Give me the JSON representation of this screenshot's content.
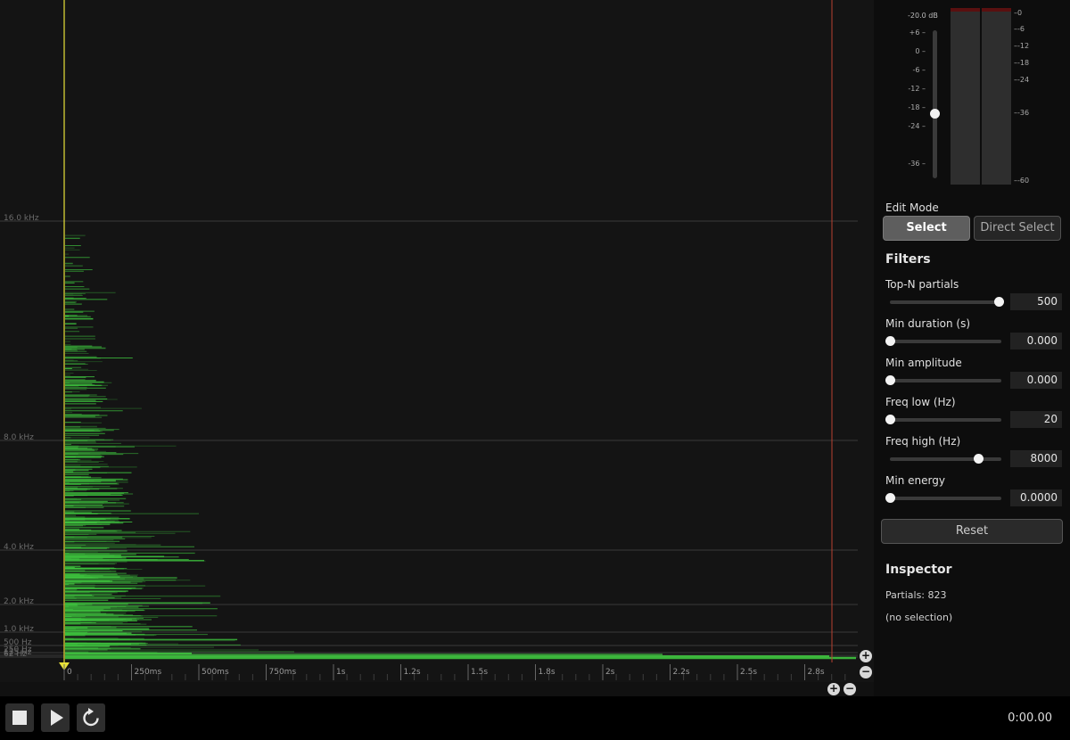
{
  "spectrogram": {
    "freq_labels": [
      "16.0 kHz",
      "8.0 kHz",
      "4.0 kHz",
      "2.0 kHz",
      "1.0 kHz",
      "500 Hz",
      "250 Hz",
      "125 Hz",
      "62 Hz"
    ],
    "time_ticks": [
      "0",
      "250ms",
      "500ms",
      "750ms",
      "1s",
      "1.2s",
      "1.5s",
      "1.8s",
      "2s",
      "2.2s",
      "2.5s",
      "2.8s"
    ],
    "zoom_in_label": "+",
    "zoom_out_label": "−",
    "playhead_color": "#e8e23a",
    "end_marker_color": "#b8412f",
    "partial_color": "#3ec43e"
  },
  "meter": {
    "gain_readout": "-20.0 dB",
    "fader_scale": [
      "+6",
      "0",
      "-6",
      "-12",
      "-18",
      "-24",
      "-36"
    ],
    "level_scale": [
      "0",
      "-6",
      "-12",
      "-18",
      "-24",
      "-36",
      "-60"
    ]
  },
  "edit_mode": {
    "label": "Edit Mode",
    "select_label": "Select",
    "direct_select_label": "Direct Select"
  },
  "filters": {
    "title": "Filters",
    "items": [
      {
        "label": "Top-N partials",
        "value": "500",
        "position": 0.98
      },
      {
        "label": "Min duration (s)",
        "value": "0.000",
        "position": 0.0
      },
      {
        "label": "Min amplitude",
        "value": "0.000",
        "position": 0.0
      },
      {
        "label": "Freq low (Hz)",
        "value": "20",
        "position": 0.0
      },
      {
        "label": "Freq high (Hz)",
        "value": "8000",
        "position": 0.8
      },
      {
        "label": "Min energy",
        "value": "0.0000",
        "position": 0.0
      }
    ],
    "reset_label": "Reset"
  },
  "inspector": {
    "title": "Inspector",
    "partials": "Partials: 823",
    "selection": "(no selection)"
  },
  "transport": {
    "time": "0:00.00"
  }
}
